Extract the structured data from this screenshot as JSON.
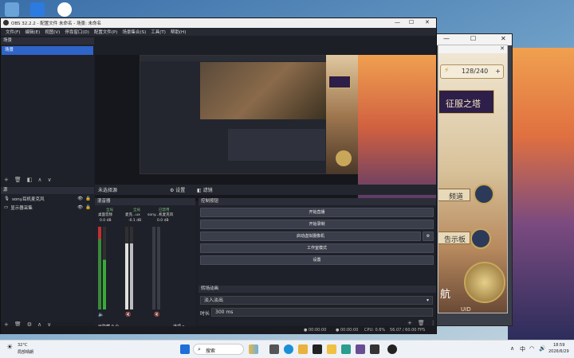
{
  "obs": {
    "title": "OBS 32.2.2 - 配置文件 未命名 - 场景: 未命名",
    "menu": [
      "文件(F)",
      "编辑(E)",
      "视图(V)",
      "停靠窗口(D)",
      "配置文件(P)",
      "场景集合(S)",
      "工具(T)",
      "帮助(H)"
    ],
    "scenes_title": "场景",
    "scene_item": "场景",
    "sources_title": "源",
    "sources": [
      "sony耳机麦克风",
      "显示器采集"
    ],
    "no_source": "未选择源",
    "settings_btn": "设置",
    "filter_btn": "滤镜",
    "mixer_title": "混音器",
    "mixer_channels": [
      {
        "label": "全局",
        "name": "桌面音频",
        "db": "0.0 dB"
      },
      {
        "label": "全局",
        "name": "麦克...ux",
        "db": "-0.1 dB"
      },
      {
        "label": "已禁用",
        "name": "sony...机麦克风",
        "db": "0.0 dB"
      }
    ],
    "hidden_count": "已隐藏 0 个",
    "options": "选项",
    "controls_title": "控制按钮",
    "controls": [
      "开始直播",
      "开始录制",
      "启动虚拟摄像机",
      "工作室模式",
      "设置"
    ],
    "transitions_title": "转场动画",
    "transition": "淡入淡出",
    "duration_label": "时长",
    "duration": "300 ms",
    "status": {
      "t1": "00:00:00",
      "t2": "00:00:00",
      "cpu": "CPU: 0.6%",
      "fps": "56.07 / 60.00 FPS"
    }
  },
  "game": {
    "stamina": "128/240",
    "banner": "征服之塔",
    "channel": "频道",
    "board": "告示板",
    "nav": "航",
    "uid": "UID 1200021843"
  },
  "taskbar": {
    "weather": "32°C",
    "weather_desc": "局部晴朗",
    "search": "搜索",
    "lang": "中",
    "time": "18:59",
    "date": "2026/6/29"
  },
  "colors": {
    "obs_bg": "#1d1f26",
    "accent": "#2f64c8",
    "taskbar": "#eef1f5"
  }
}
